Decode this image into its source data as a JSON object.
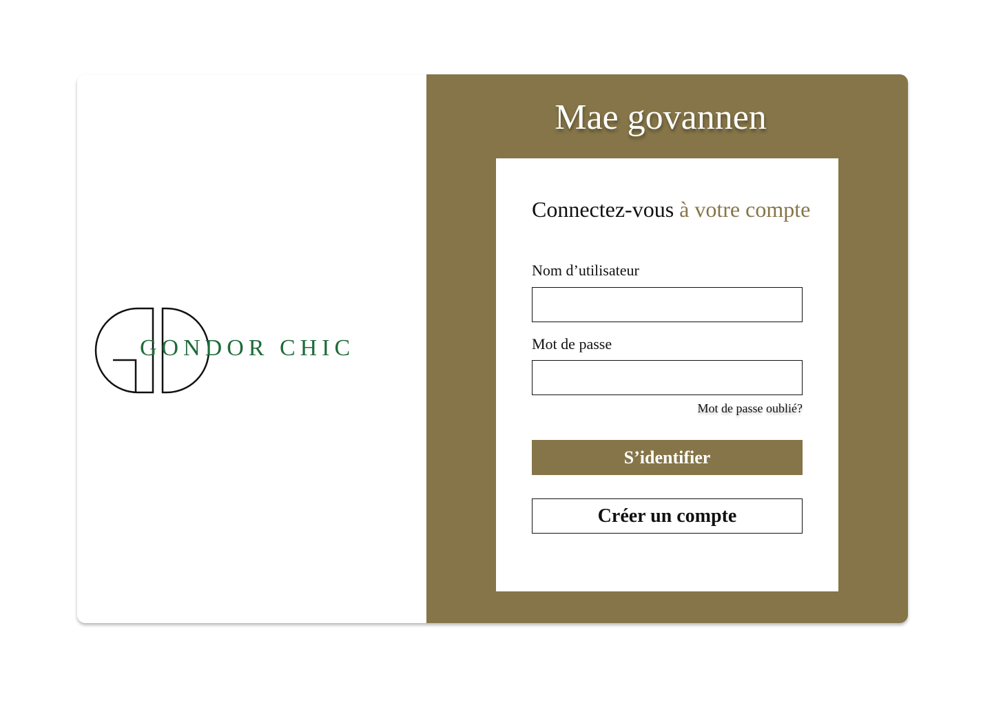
{
  "brand": {
    "name": "GONDOR CHIC",
    "logo_icon": "gondor-chic-monogram-icon",
    "brand_color": "#1f6b3a"
  },
  "theme": {
    "accent": "#857548",
    "text": "#111111",
    "surface": "#ffffff"
  },
  "welcome": {
    "title": "Mae govannen"
  },
  "login_form": {
    "title_main": "Connectez-vous",
    "title_accent": "à votre compte",
    "username_label": "Nom d’utilisateur",
    "username_value": "",
    "password_label": "Mot de passe",
    "password_value": "",
    "forgot_password": "Mot de passe oublié?",
    "submit_label": "S’identifier",
    "create_account_label": "Créer un compte"
  }
}
